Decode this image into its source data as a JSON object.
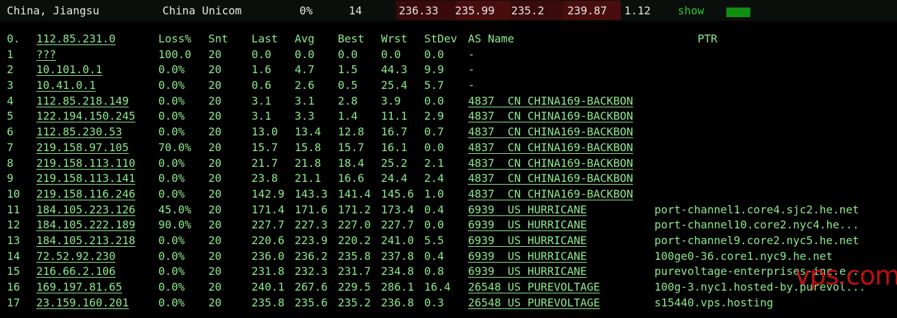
{
  "topbar": {
    "location": "China, Jiangsu",
    "isp": "China Unicom",
    "loss": "0%",
    "snt": "14",
    "last": "236.33",
    "avg": "235.99",
    "best": "235.2",
    "wrst": "239.87",
    "stdev": "1.12",
    "show_label": "show"
  },
  "header": {
    "hop": "0.",
    "host": "112.85.231.0",
    "loss": "Loss%",
    "snt": "Snt",
    "last": "Last",
    "avg": "Avg",
    "best": "Best",
    "wrst": "Wrst",
    "stdev": "StDev",
    "as": "AS Name",
    "ptr": "PTR"
  },
  "rows": [
    {
      "hop": "1",
      "host": "???",
      "loss": "100.0",
      "snt": "20",
      "last": "0.0",
      "avg": "0.0",
      "best": "0.0",
      "wrst": "0.0",
      "stdev": "0.0",
      "as": "-",
      "ptr": ""
    },
    {
      "hop": "2",
      "host": "10.101.0.1",
      "loss": "0.0%",
      "snt": "20",
      "last": "1.6",
      "avg": "4.7",
      "best": "1.5",
      "wrst": "44.3",
      "stdev": "9.9",
      "as": "-",
      "ptr": ""
    },
    {
      "hop": "3",
      "host": "10.41.0.1",
      "loss": "0.0%",
      "snt": "20",
      "last": "0.6",
      "avg": "2.6",
      "best": "0.5",
      "wrst": "25.4",
      "stdev": "5.7",
      "as": "-",
      "ptr": ""
    },
    {
      "hop": "4",
      "host": "112.85.218.149",
      "loss": "0.0%",
      "snt": "20",
      "last": "3.1",
      "avg": "3.1",
      "best": "2.8",
      "wrst": "3.9",
      "stdev": "0.0",
      "as": "4837  CN CHINA169-BACKBON",
      "ptr": ""
    },
    {
      "hop": "5",
      "host": "122.194.150.245",
      "loss": "0.0%",
      "snt": "20",
      "last": "3.1",
      "avg": "3.3",
      "best": "1.4",
      "wrst": "11.1",
      "stdev": "2.9",
      "as": "4837  CN CHINA169-BACKBON",
      "ptr": ""
    },
    {
      "hop": "6",
      "host": "112.85.230.53",
      "loss": "0.0%",
      "snt": "20",
      "last": "13.0",
      "avg": "13.4",
      "best": "12.8",
      "wrst": "16.7",
      "stdev": "0.7",
      "as": "4837  CN CHINA169-BACKBON",
      "ptr": ""
    },
    {
      "hop": "7",
      "host": "219.158.97.105",
      "loss": "70.0%",
      "snt": "20",
      "last": "15.7",
      "avg": "15.8",
      "best": "15.7",
      "wrst": "16.1",
      "stdev": "0.0",
      "as": "4837  CN CHINA169-BACKBON",
      "ptr": ""
    },
    {
      "hop": "8",
      "host": "219.158.113.110",
      "loss": "0.0%",
      "snt": "20",
      "last": "21.7",
      "avg": "21.8",
      "best": "18.4",
      "wrst": "25.2",
      "stdev": "2.1",
      "as": "4837  CN CHINA169-BACKBON",
      "ptr": ""
    },
    {
      "hop": "9",
      "host": "219.158.113.141",
      "loss": "0.0%",
      "snt": "20",
      "last": "23.8",
      "avg": "21.1",
      "best": "16.6",
      "wrst": "24.4",
      "stdev": "2.4",
      "as": "4837  CN CHINA169-BACKBON",
      "ptr": ""
    },
    {
      "hop": "10",
      "host": "219.158.116.246",
      "loss": "0.0%",
      "snt": "20",
      "last": "142.9",
      "avg": "143.3",
      "best": "141.4",
      "wrst": "145.6",
      "stdev": "1.0",
      "as": "4837  CN CHINA169-BACKBON",
      "ptr": ""
    },
    {
      "hop": "11",
      "host": "184.105.223.126",
      "loss": "45.0%",
      "snt": "20",
      "last": "171.4",
      "avg": "171.6",
      "best": "171.2",
      "wrst": "173.4",
      "stdev": "0.4",
      "as": "6939  US HURRICANE",
      "ptr": "port-channel1.core4.sjc2.he.net"
    },
    {
      "hop": "12",
      "host": "184.105.222.189",
      "loss": "90.0%",
      "snt": "20",
      "last": "227.7",
      "avg": "227.3",
      "best": "227.0",
      "wrst": "227.7",
      "stdev": "0.0",
      "as": "6939  US HURRICANE",
      "ptr": "port-channel10.core2.nyc4.he..."
    },
    {
      "hop": "13",
      "host": "184.105.213.218",
      "loss": "0.0%",
      "snt": "20",
      "last": "220.6",
      "avg": "223.9",
      "best": "220.2",
      "wrst": "241.0",
      "stdev": "5.5",
      "as": "6939  US HURRICANE",
      "ptr": "port-channel9.core2.nyc5.he.net"
    },
    {
      "hop": "14",
      "host": "72.52.92.230",
      "loss": "0.0%",
      "snt": "20",
      "last": "236.0",
      "avg": "236.2",
      "best": "235.8",
      "wrst": "237.8",
      "stdev": "0.4",
      "as": "6939  US HURRICANE",
      "ptr": "100ge0-36.core1.nyc9.he.net"
    },
    {
      "hop": "15",
      "host": "216.66.2.106",
      "loss": "0.0%",
      "snt": "20",
      "last": "231.8",
      "avg": "232.3",
      "best": "231.7",
      "wrst": "234.8",
      "stdev": "0.8",
      "as": "6939  US HURRICANE",
      "ptr": "purevoltage-enterprises-inc.e..."
    },
    {
      "hop": "16",
      "host": "169.197.81.65",
      "loss": "0.0%",
      "snt": "20",
      "last": "240.1",
      "avg": "267.6",
      "best": "229.5",
      "wrst": "286.1",
      "stdev": "16.4",
      "as": "26548 US PUREVOLTAGE",
      "ptr": "100g-3.nyc1.hosted-by.purevol..."
    },
    {
      "hop": "17",
      "host": "23.159.160.201",
      "loss": "0.0%",
      "snt": "20",
      "last": "235.8",
      "avg": "235.6",
      "best": "235.2",
      "wrst": "236.8",
      "stdev": "0.3",
      "as": "26548 US PUREVOLTAGE",
      "ptr": "s15440.vps.hosting"
    }
  ],
  "watermark": "vps.com",
  "colors": {
    "background": "#000000",
    "text_green": "#8eea8e",
    "topbar_heat_1": "#3a0a0a",
    "topbar_heat_2": "#4a0d0d",
    "show_bar": "#118f11"
  }
}
